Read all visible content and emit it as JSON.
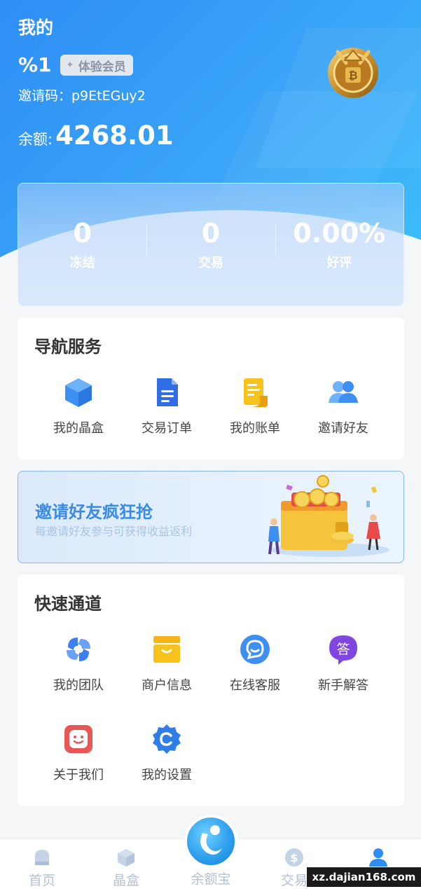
{
  "header": {
    "title": "我的",
    "username": "%1",
    "member_badge": "体验会员",
    "invite_code": "邀请码：p9EtEGuy2",
    "balance_label": "余额:",
    "balance_value": "4268.01"
  },
  "stats": [
    {
      "value": "0",
      "label": "冻结"
    },
    {
      "value": "0",
      "label": "交易"
    },
    {
      "value": "0.00%",
      "label": "好评"
    }
  ],
  "nav_section": {
    "title": "导航服务",
    "items": [
      {
        "label": "我的晶盒",
        "icon": "cube-icon",
        "color": "#3d8ff2"
      },
      {
        "label": "交易订单",
        "icon": "document-icon",
        "color": "#2f6ee6"
      },
      {
        "label": "我的账单",
        "icon": "bill-icon",
        "color": "#f5b80f"
      },
      {
        "label": "邀请好友",
        "icon": "friends-icon",
        "color": "#3d8ff2"
      }
    ]
  },
  "banner": {
    "title": "邀请好友疯狂抢",
    "subtitle": "每邀请好友参与可获得收益返利"
  },
  "quick_section": {
    "title": "快速通道",
    "items": [
      {
        "label": "我的团队",
        "icon": "team-icon",
        "color": "#3d7ef0"
      },
      {
        "label": "商户信息",
        "icon": "shop-icon",
        "color": "#f7b51a"
      },
      {
        "label": "在线客服",
        "icon": "chat-icon",
        "color": "#3d8ff2"
      },
      {
        "label": "新手解答",
        "icon": "qa-icon",
        "color": "#8047e0",
        "glyph": "答"
      },
      {
        "label": "关于我们",
        "icon": "about-icon",
        "color": "#e85656"
      },
      {
        "label": "我的设置",
        "icon": "settings-icon",
        "color": "#2f7ee8"
      }
    ]
  },
  "tabbar": {
    "items": [
      {
        "label": "首页",
        "icon": "home-icon"
      },
      {
        "label": "晶盒",
        "icon": "cube-icon"
      },
      {
        "label": "余额宝",
        "icon": "balance-icon"
      },
      {
        "label": "交易",
        "icon": "dollar-icon"
      },
      {
        "label": "我的",
        "icon": "user-icon",
        "active": true
      }
    ],
    "active_color": "#2f8cf0",
    "inactive_color": "#b3c2d4"
  },
  "watermark": "xz.dajian168.com"
}
